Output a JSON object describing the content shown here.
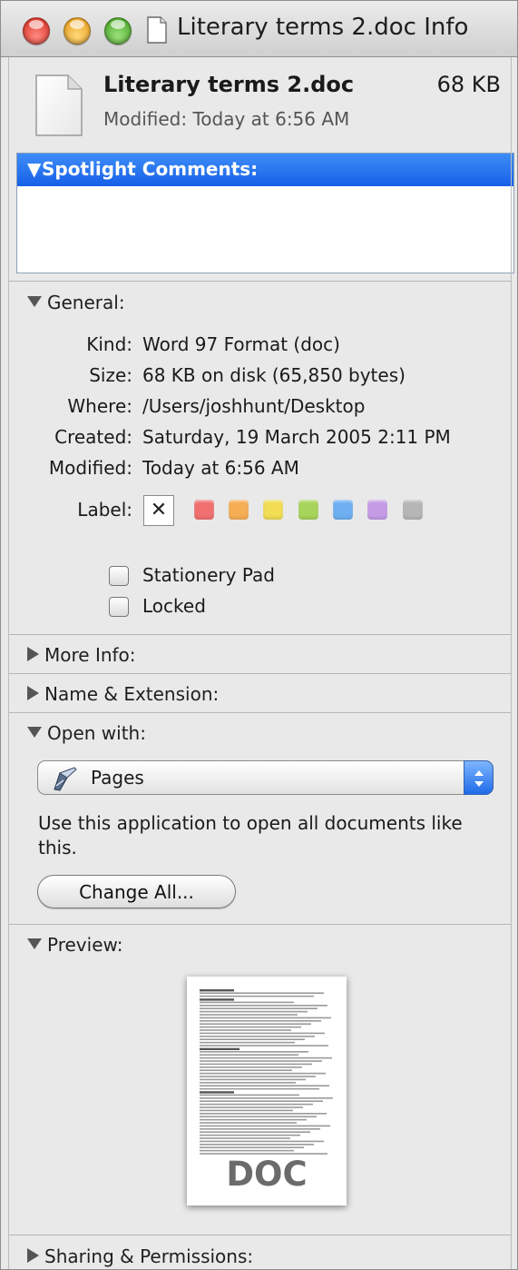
{
  "window": {
    "title": "Literary terms 2.doc Info",
    "traffic_lights": [
      "close-button",
      "minimize-button",
      "zoom-button"
    ]
  },
  "header": {
    "file_name": "Literary terms 2.doc",
    "file_size": "68 KB",
    "modified": "Modified: Today at 6:56 AM"
  },
  "spotlight": {
    "heading": "Spotlight Comments:",
    "value": ""
  },
  "general": {
    "heading": "General:",
    "rows": [
      {
        "label": "Kind:",
        "value": "Word 97 Format (doc)"
      },
      {
        "label": "Size:",
        "value": "68 KB on disk (65,850 bytes)"
      },
      {
        "label": "Where:",
        "value": "/Users/joshhunt/Desktop"
      },
      {
        "label": "Created:",
        "value": "Saturday, 19 March 2005 2:11 PM"
      },
      {
        "label": "Modified:",
        "value": "Today at 6:56 AM"
      }
    ],
    "label_caption": "Label:",
    "label_none_glyph": "✕",
    "label_colors": [
      "#f07070",
      "#f6ae55",
      "#f2dd55",
      "#a7d45a",
      "#6fb0f2",
      "#c59be6",
      "#b6b6b6"
    ],
    "stationery_label": "Stationery Pad",
    "stationery_checked": false,
    "locked_label": "Locked",
    "locked_checked": false
  },
  "more_info": {
    "heading": "More Info:"
  },
  "name_ext": {
    "heading": "Name & Extension:"
  },
  "open_with": {
    "heading": "Open with:",
    "app": "Pages",
    "app_icon": "pages-app-icon",
    "help": "Use this application to open all documents like this.",
    "change_all": "Change All..."
  },
  "preview": {
    "heading": "Preview:",
    "badge": "DOC"
  },
  "sharing": {
    "heading": "Sharing & Permissions:"
  },
  "colors": {
    "accent": "#1660e8",
    "window_bg": "#e9e9e9"
  }
}
